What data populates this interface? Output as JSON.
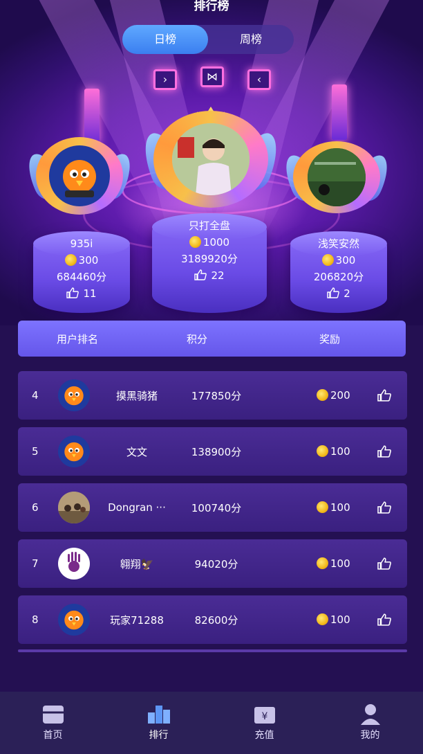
{
  "header": {
    "title": "排行榜"
  },
  "tabs": [
    {
      "label": "日榜",
      "active": true
    },
    {
      "label": "周榜",
      "active": false
    }
  ],
  "podium": [
    {
      "place": 2,
      "name": "935i",
      "coins": "300",
      "score": "684460分",
      "likes": "11"
    },
    {
      "place": 1,
      "name": "只打全盘",
      "coins": "1000",
      "score": "3189920分",
      "likes": "22"
    },
    {
      "place": 3,
      "name": "浅笑安然",
      "coins": "300",
      "score": "206820分",
      "likes": "2"
    }
  ],
  "table_header": {
    "col_user": "用户排名",
    "col_score": "积分",
    "col_reward": "奖励"
  },
  "rows": [
    {
      "rank": "4",
      "name": "摸黑骑猪",
      "score": "177850分",
      "reward": "200",
      "avatar": "bird-avatar"
    },
    {
      "rank": "5",
      "name": "文文",
      "score": "138900分",
      "reward": "100",
      "avatar": "bird-avatar"
    },
    {
      "rank": "6",
      "name": "Dongran ···",
      "score": "100740分",
      "reward": "100",
      "avatar": "photo-avatar"
    },
    {
      "rank": "7",
      "name": "翱翔🦅",
      "score": "94020分",
      "reward": "100",
      "avatar": "handprint-avatar"
    },
    {
      "rank": "8",
      "name": "玩家71288",
      "score": "82600分",
      "reward": "100",
      "avatar": "bird-avatar"
    }
  ],
  "nav": [
    {
      "label": "首页",
      "icon": "home-icon"
    },
    {
      "label": "排行",
      "icon": "ranking-icon",
      "active": true
    },
    {
      "label": "充值",
      "icon": "wallet-icon"
    },
    {
      "label": "我的",
      "icon": "profile-icon"
    }
  ],
  "colors": {
    "accent": "#3b7ff0",
    "coin": "#f2b81a",
    "row_bg": "#3a2080",
    "header_bg": "#6556ea"
  }
}
